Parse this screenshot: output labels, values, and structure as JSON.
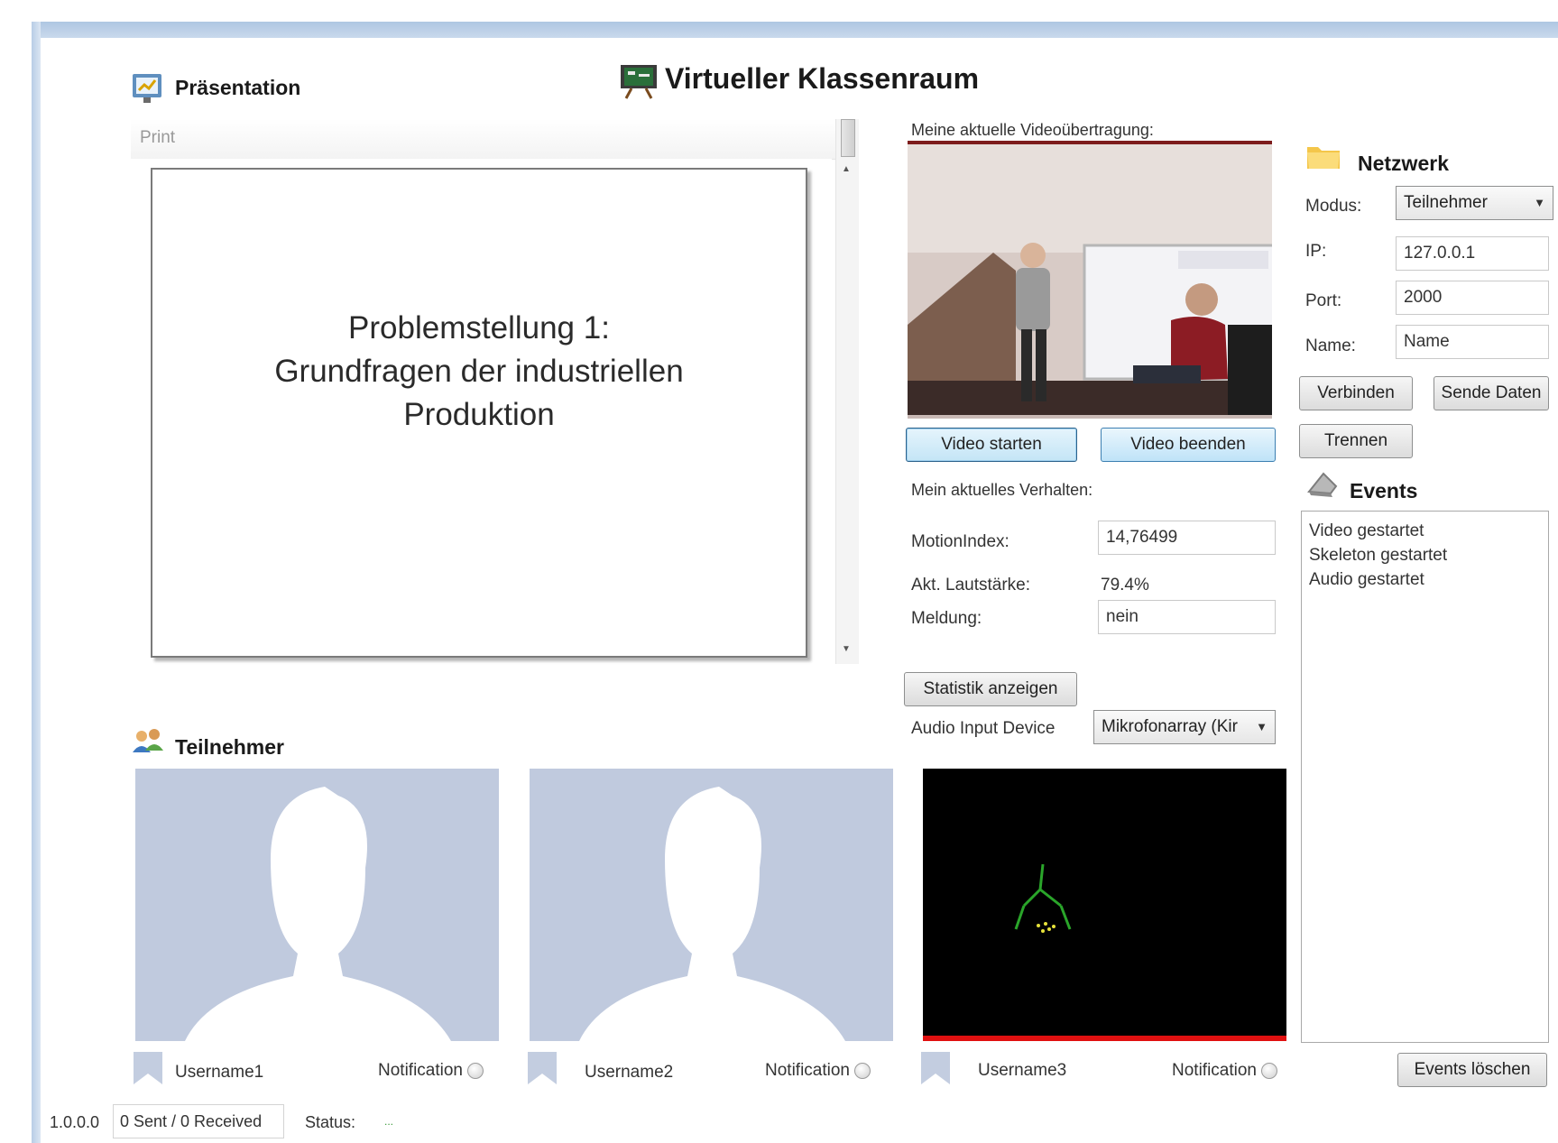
{
  "app": {
    "title": "Virtueller Klassenraum"
  },
  "presentation": {
    "title": "Präsentation",
    "toolbar_label": "Print",
    "slide_line1": "Problemstellung 1:",
    "slide_line2": "Grundfragen der industriellen",
    "slide_line3": "Produktion"
  },
  "video": {
    "caption": "Meine aktuelle Videoübertragung:",
    "start_label": "Video starten",
    "stop_label": "Video beenden"
  },
  "behavior": {
    "caption": "Mein aktuelles Verhalten:",
    "motion_label": "MotionIndex:",
    "motion_value": "14,76499",
    "volume_label": "Akt. Lautstärke:",
    "volume_value": "79.4%",
    "report_label": "Meldung:",
    "report_value": "nein",
    "stats_button": "Statistik anzeigen",
    "audio_label": "Audio Input Device",
    "audio_value": "Mikrofonarray (Kir"
  },
  "network": {
    "title": "Netzwerk",
    "mode_label": "Modus:",
    "mode_value": "Teilnehmer",
    "ip_label": "IP:",
    "ip_value": "127.0.0.1",
    "port_label": "Port:",
    "port_value": "2000",
    "name_label": "Name:",
    "name_value": "Name",
    "connect_button": "Verbinden",
    "send_button": "Sende Daten",
    "disconnect_button": "Trennen"
  },
  "events": {
    "title": "Events",
    "items": [
      "Video gestartet",
      "Skeleton gestartet",
      "Audio gestartet"
    ],
    "clear_button": "Events löschen"
  },
  "participants": {
    "title": "Teilnehmer",
    "users": [
      {
        "name": "Username1",
        "notification": "Notification"
      },
      {
        "name": "Username2",
        "notification": "Notification"
      },
      {
        "name": "Username3",
        "notification": "Notification"
      }
    ]
  },
  "statusbar": {
    "version": "1.0.0.0",
    "traffic": "0 Sent / 0 Received",
    "status_label": "Status:",
    "status_value": "..."
  },
  "colors": {
    "silhouette_bg": "#c0cade",
    "skeleton_color": "#2aa52a",
    "kinect_bar": "#e01010"
  },
  "icons": [
    "presentation-icon",
    "classroom-icon",
    "network-folder-icon",
    "events-icon",
    "participants-icon",
    "user-bookmark-icon"
  ]
}
